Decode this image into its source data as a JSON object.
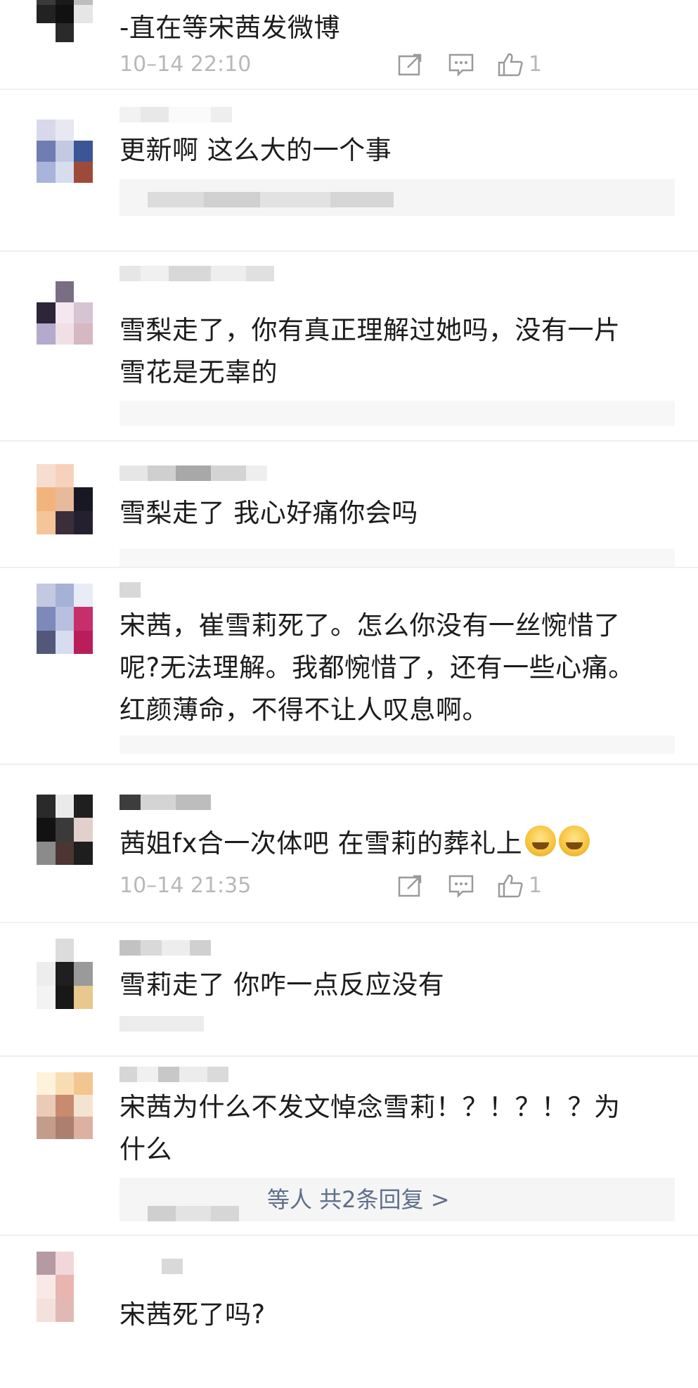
{
  "comments": [
    {
      "text": "-直在等宋茜发微博",
      "time": "10–14 22:10",
      "like_count": "1"
    },
    {
      "text": "更新啊 这么大的一个事",
      "reply_preview": "。。。。。。"
    },
    {
      "text_lines": [
        "雪梨走了，你有真正理解过她吗，没有一片",
        "雪花是无辜的"
      ]
    },
    {
      "text": "雪梨走了 我心好痛你会吗"
    },
    {
      "text_lines": [
        "宋茜，崔雪莉死了。怎么你没有一丝惋惜了",
        "呢?无法理解。我都惋惜了，还有一些心痛。",
        "红颜薄命，不得不让人叹息啊。"
      ]
    },
    {
      "text": "茜姐fx合一次体吧 在雪莉的葬礼上",
      "emoji_names": [
        "crying-face-icon",
        "crying-face-icon"
      ],
      "time": "10–14 21:35",
      "like_count": "1"
    },
    {
      "text": "雪莉走了 你咋一点反应没有"
    },
    {
      "text_lines": [
        "宋茜为什么不发文悼念雪莉！？！？！？为",
        "什么"
      ],
      "reply_summary": "等人 共2条回复 >"
    },
    {
      "text": "宋茜死了吗?"
    }
  ],
  "colors": {
    "text": "#1c1c1c",
    "meta": "#b8b8b8",
    "link": "#5f6f8c",
    "reply_bg": "#f5f5f5"
  }
}
